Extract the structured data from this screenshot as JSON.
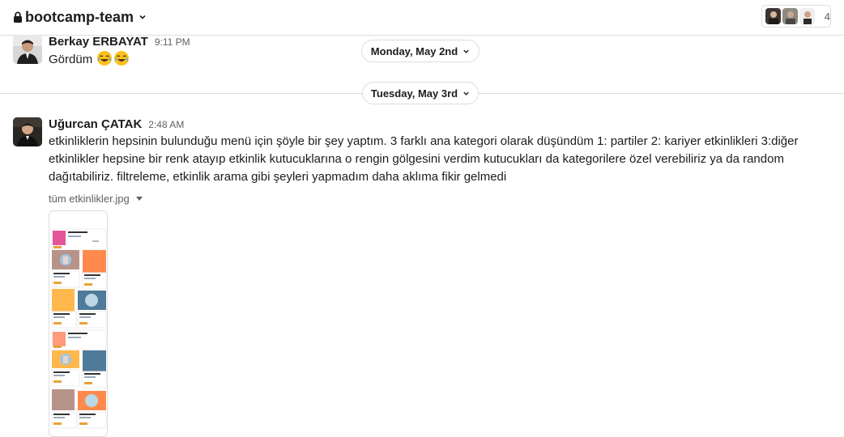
{
  "header": {
    "channel_name": "bootcamp-team",
    "lock_icon": "lock-icon",
    "member_count": "4"
  },
  "messages": [
    {
      "author": "Berkay ERBAYAT",
      "time": "9:11 PM",
      "text": "Gördüm",
      "emoji": [
        "joy-emoji",
        "joy-emoji"
      ]
    },
    {
      "author": "Uğurcan ÇATAK",
      "time": "2:48 AM",
      "text_lines": [
        "etkinliklerin hepsinin bulunduğu menü için şöyle bir şey yaptım. 3 farklı ana kategori olarak düşündüm 1: partiler 2: kariyer etkinlikleri 3:diğer",
        "etkinlikler hepsine bir renk atayıp etkinlik kutucuklarına o rengin gölgesini verdim kutucukları da kategorilere özel verebiliriz ya da random",
        "dağıtabiliriz. filtreleme, etkinlik arama gibi şeyleri yapmadım daha aklıma fikir gelmedi"
      ],
      "file": {
        "name": "tüm etkinlikler.jpg"
      }
    }
  ],
  "dividers": {
    "first": "Monday, May 2nd",
    "second": "Tuesday, May 3rd"
  },
  "colors": {
    "accent_pink": "#e5559b",
    "accent_orange": "#ff8a4c",
    "accent_salmon": "#ff9a7a",
    "accent_teal": "#4f7a99",
    "accent_yellow": "#ffb84d",
    "accent_taupe": "#b8938a"
  }
}
